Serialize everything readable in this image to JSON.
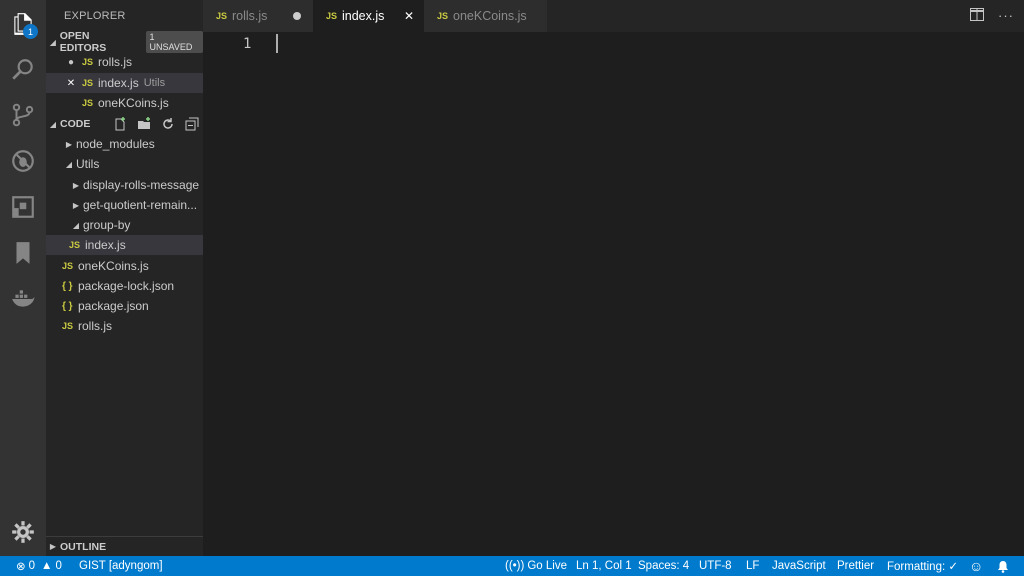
{
  "activity_bar": {
    "explorer_badge": "1",
    "icons": [
      "files-icon",
      "search-icon",
      "source-control-icon",
      "debug-icon",
      "extensions-icon",
      "bookmark-icon",
      "docker-icon",
      "gear-icon"
    ]
  },
  "sidebar": {
    "title": "EXPLORER",
    "open_editors": {
      "label": "OPEN EDITORS",
      "badge": "1 UNSAVED",
      "items": [
        {
          "name": "rolls.js",
          "desc": "",
          "control": "dot"
        },
        {
          "name": "index.js",
          "desc": "Utils",
          "control": "close"
        },
        {
          "name": "oneKCoins.js",
          "desc": "",
          "control": "none"
        }
      ]
    },
    "code": {
      "label": "CODE",
      "tree": [
        {
          "name": "node_modules",
          "type": "folder",
          "expanded": false
        },
        {
          "name": "Utils",
          "type": "folder",
          "expanded": true
        },
        {
          "name": "display-rolls-message",
          "type": "folder",
          "expanded": false
        },
        {
          "name": "get-quotient-remain...",
          "type": "folder",
          "expanded": false
        },
        {
          "name": "group-by",
          "type": "folder",
          "expanded": true
        },
        {
          "name": "index.js",
          "type": "js"
        },
        {
          "name": "oneKCoins.js",
          "type": "js"
        },
        {
          "name": "package-lock.json",
          "type": "json"
        },
        {
          "name": "package.json",
          "type": "json"
        },
        {
          "name": "rolls.js",
          "type": "js"
        }
      ]
    },
    "outline_label": "OUTLINE"
  },
  "tabs": [
    {
      "label": "rolls.js",
      "state": "inactive-dirty"
    },
    {
      "label": "index.js",
      "state": "active"
    },
    {
      "label": "oneKCoins.js",
      "state": "inactive"
    }
  ],
  "editor": {
    "line_number": "1"
  },
  "status_bar": {
    "errors": "0",
    "warnings": "0",
    "gist": "GIST [adyngom]",
    "go_live": "Go Live",
    "position": "Ln 1, Col 1",
    "spaces": "Spaces: 4",
    "encoding": "UTF-8",
    "eol": "LF",
    "language": "JavaScript",
    "prettier": "Prettier",
    "formatting": "Formatting: ✓"
  },
  "colors": {
    "activity_bar": "#333333",
    "sidebar": "#252526",
    "editor": "#1e1e1e",
    "status_bar": "#007acc",
    "js_icon": "#cbcb41",
    "badge": "#0e75c7"
  }
}
